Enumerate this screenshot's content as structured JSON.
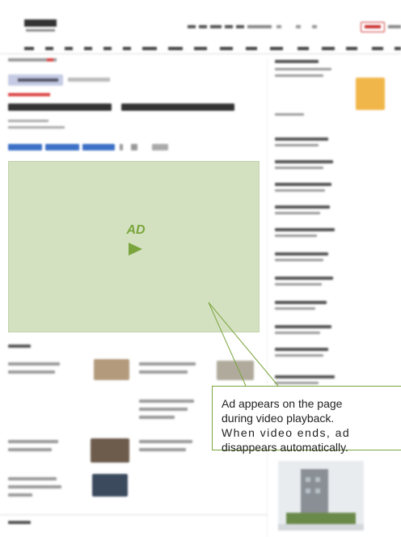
{
  "video_player": {
    "ad_label": "AD"
  },
  "callout": {
    "line1": "Ad appears on the page",
    "line2": "during video playback.",
    "line3": "When video ends, ad",
    "line4": "disappears automatically."
  },
  "colors": {
    "ad_area": "#d4e1c1",
    "accent_green": "#7aa53d",
    "sidebar_promo": "#f1b649",
    "share_blue": "#3c6fc6"
  },
  "icons": {
    "ad_play": "play-icon"
  }
}
